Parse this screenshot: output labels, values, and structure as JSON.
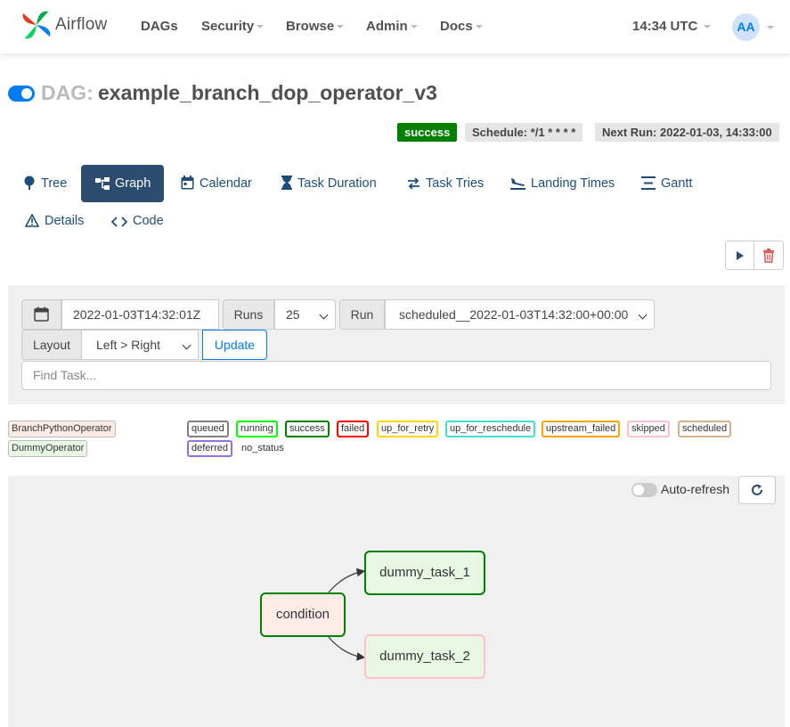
{
  "navbar": {
    "logo_text": "Airflow",
    "menu": [
      "DAGs",
      "Security",
      "Browse",
      "Admin",
      "Docs"
    ],
    "time": "14:34 UTC",
    "avatar": "AA"
  },
  "dag": {
    "prefix": "DAG:",
    "name": "example_branch_dop_operator_v3",
    "status": "success",
    "schedule": "Schedule: */1 * * * *",
    "next_run": "Next Run: 2022-01-03, 14:33:00",
    "paused": false
  },
  "tabs": [
    {
      "label": "Tree",
      "icon": "tree-icon"
    },
    {
      "label": "Graph",
      "icon": "graph-icon",
      "active": true
    },
    {
      "label": "Calendar",
      "icon": "calendar-icon"
    },
    {
      "label": "Task Duration",
      "icon": "hourglass-icon"
    },
    {
      "label": "Task Tries",
      "icon": "swap-icon"
    },
    {
      "label": "Landing Times",
      "icon": "plane-landing-icon"
    },
    {
      "label": "Gantt",
      "icon": "gantt-icon"
    },
    {
      "label": "Details",
      "icon": "warning-icon"
    },
    {
      "label": "Code",
      "icon": "code-icon"
    }
  ],
  "form": {
    "base_date": "2022-01-03T14:32:01Z",
    "runs_label": "Runs",
    "runs_value": "25",
    "run_label": "Run",
    "run_value": "scheduled__2022-01-03T14:32:00+00:00",
    "layout_label": "Layout",
    "layout_value": "Left > Right",
    "update_label": "Update",
    "find_placeholder": "Find Task..."
  },
  "legend": {
    "operators": [
      {
        "label": "BranchPythonOperator",
        "color": "#ffebe5"
      },
      {
        "label": "DummyOperator",
        "color": "#e8f7e4"
      }
    ],
    "states": [
      {
        "label": "queued",
        "color": "#808080"
      },
      {
        "label": "running",
        "color": "#00ff00"
      },
      {
        "label": "success",
        "color": "#008000"
      },
      {
        "label": "failed",
        "color": "#ff0000"
      },
      {
        "label": "up_for_retry",
        "color": "#ffd700"
      },
      {
        "label": "up_for_reschedule",
        "color": "#40e0d0"
      },
      {
        "label": "upstream_failed",
        "color": "#ffa500"
      },
      {
        "label": "skipped",
        "color": "#ffc0cb"
      },
      {
        "label": "scheduled",
        "color": "#d2b48c"
      },
      {
        "label": "deferred",
        "color": "#9370db"
      },
      {
        "label": "no_status",
        "color": ""
      }
    ]
  },
  "graph": {
    "auto_refresh_label": "Auto-refresh",
    "auto_refresh": false,
    "nodes": [
      {
        "label": "condition",
        "state": "success",
        "operator": "BranchPythonOperator"
      },
      {
        "label": "dummy_task_1",
        "state": "success",
        "operator": "DummyOperator"
      },
      {
        "label": "dummy_task_2",
        "state": "skipped",
        "operator": "DummyOperator"
      }
    ],
    "edges": [
      [
        "condition",
        "dummy_task_1"
      ],
      [
        "condition",
        "dummy_task_2"
      ]
    ]
  }
}
